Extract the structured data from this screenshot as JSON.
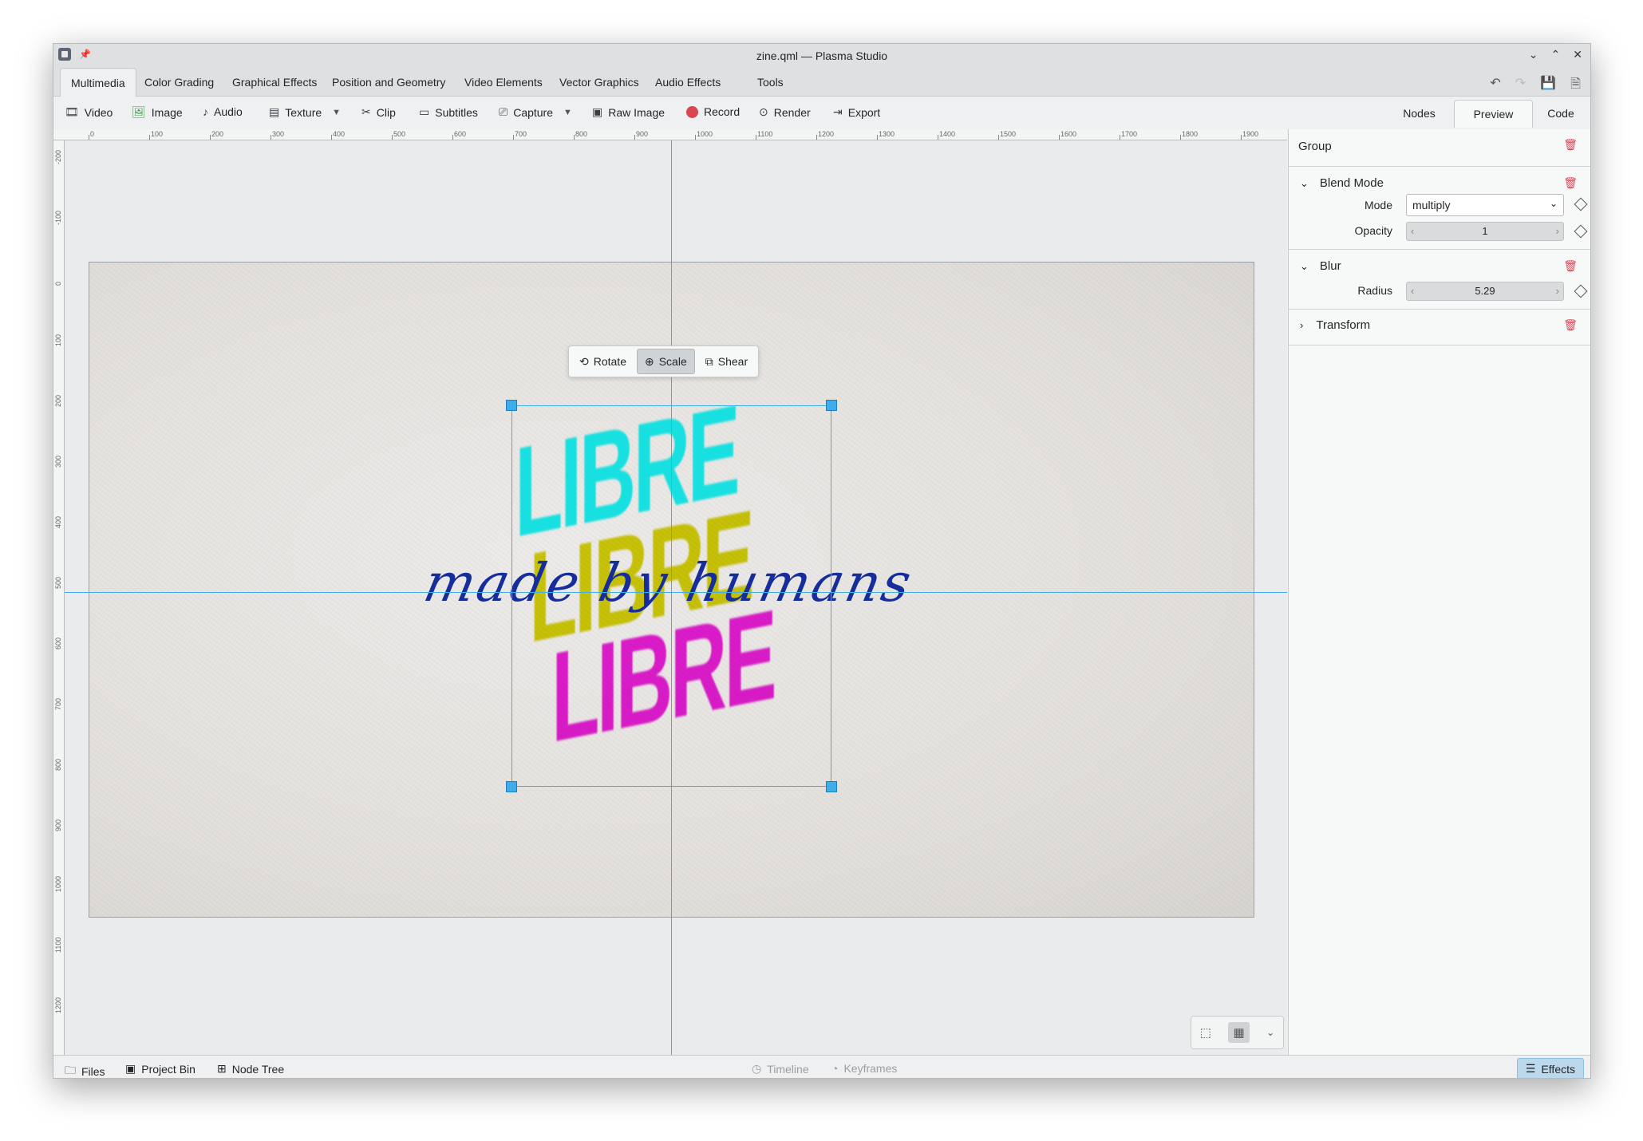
{
  "window": {
    "title": "zine.qml — Plasma Studio"
  },
  "menu_tabs": [
    "Multimedia",
    "Color Grading",
    "Graphical Effects",
    "Position and Geometry",
    "Video Elements",
    "Vector Graphics",
    "Audio Effects",
    "Tools"
  ],
  "toolbar": {
    "video": "Video",
    "image": "Image",
    "audio": "Audio",
    "texture": "Texture",
    "clip": "Clip",
    "subtitles": "Subtitles",
    "capture": "Capture",
    "raw_image": "Raw Image",
    "record": "Record",
    "render": "Render",
    "export": "Export"
  },
  "right_tabs": [
    "Nodes",
    "Preview",
    "Code"
  ],
  "ruler": {
    "h": [
      "0",
      "100",
      "200",
      "300",
      "400",
      "500",
      "600",
      "700",
      "800",
      "900",
      "1000",
      "1100",
      "1200",
      "1300",
      "1400",
      "1500",
      "1600",
      "1700",
      "1800",
      "1900"
    ],
    "v": [
      "-200",
      "-100",
      "0",
      "100",
      "200",
      "300",
      "400",
      "500",
      "600",
      "700",
      "800",
      "900",
      "1000",
      "1100",
      "1200"
    ]
  },
  "artwork": {
    "word": "LIBRE",
    "script": "made by humans"
  },
  "transform_popup": {
    "rotate": "Rotate",
    "scale": "Scale",
    "shear": "Shear"
  },
  "panel": {
    "group": "Group",
    "blend": {
      "title": "Blend Mode",
      "mode_label": "Mode",
      "mode_value": "multiply",
      "opacity_label": "Opacity",
      "opacity_value": "1"
    },
    "blur": {
      "title": "Blur",
      "radius_label": "Radius",
      "radius_value": "5.29"
    },
    "transform": {
      "title": "Transform"
    }
  },
  "status": {
    "files": "Files",
    "project_bin": "Project Bin",
    "node_tree": "Node Tree",
    "timeline": "Timeline",
    "keyframes": "Keyframes",
    "effects": "Effects"
  },
  "colors": {
    "accent": "#3daee9",
    "delete": "#da4453",
    "cyan": "#19e0e0",
    "yellow": "#d7d308",
    "magenta": "#ee1ee0",
    "script": "#152e9c"
  }
}
